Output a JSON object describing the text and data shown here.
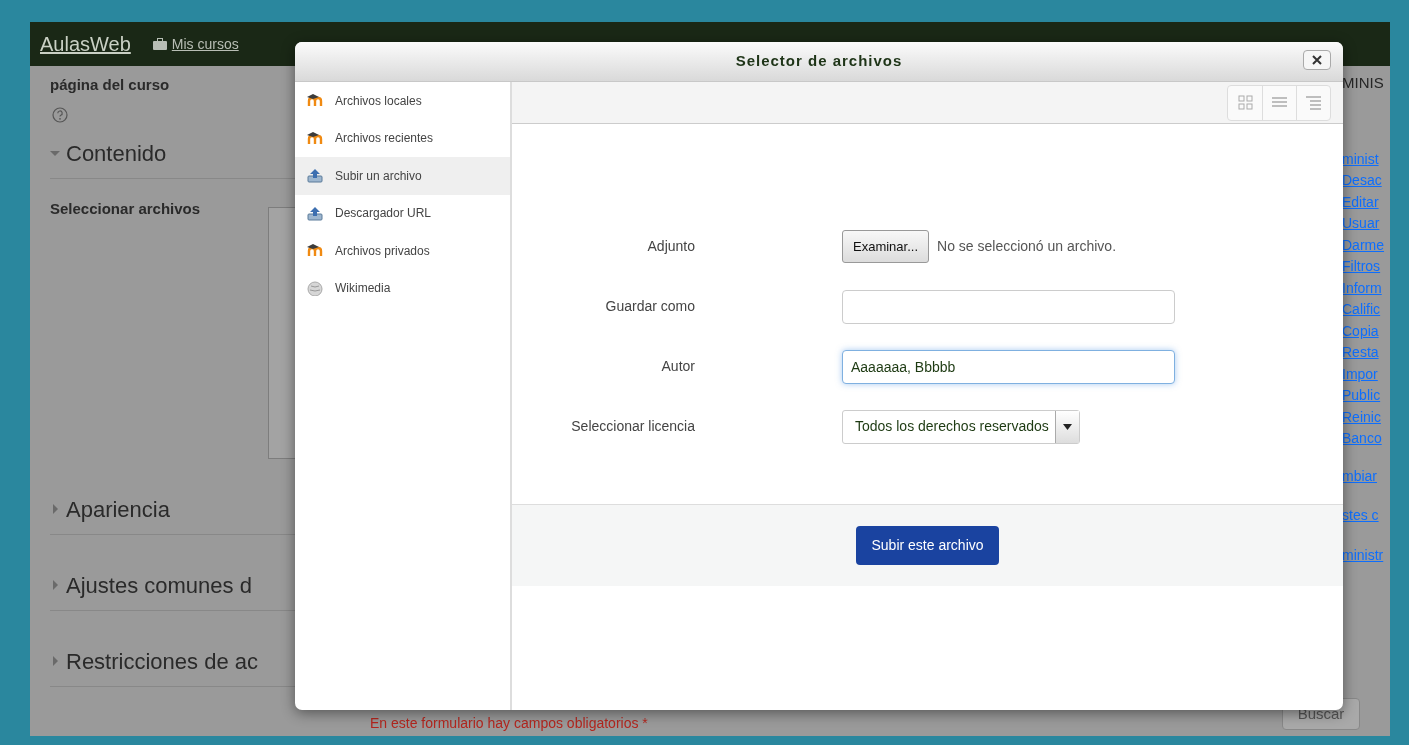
{
  "navbar": {
    "brand": "AulasWeb",
    "menu": "Mis cursos"
  },
  "course_form": {
    "description_label": "página del curso",
    "sections": [
      {
        "title": "Contenido",
        "expanded": true
      },
      {
        "title": "Apariencia",
        "expanded": false
      },
      {
        "title": "Ajustes comunes d",
        "expanded": false
      },
      {
        "title": "Restricciones de ac",
        "expanded": false
      }
    ],
    "files_label": "Seleccionar archivos",
    "required_notice": "En este formulario hay campos obligatorios",
    "required_mark": "*"
  },
  "admin_block": {
    "title": "MINIS",
    "items": [
      "minist",
      "Desac",
      "Editar",
      "Usuar",
      "Darme",
      "Filtros",
      "Inform",
      "Calific",
      "Copia",
      "Resta",
      "Impor",
      "Public",
      "Reinic",
      "Banco"
    ],
    "links": [
      "mbiar",
      "stes c",
      "ministr"
    ],
    "search_button": "Buscar"
  },
  "file_picker": {
    "title": "Selector de archivos",
    "repositories": [
      {
        "label": "Archivos locales",
        "kind": "moodle",
        "selected": false
      },
      {
        "label": "Archivos recientes",
        "kind": "moodle",
        "selected": false
      },
      {
        "label": "Subir un archivo",
        "kind": "upload",
        "selected": true
      },
      {
        "label": "Descargador URL",
        "kind": "upload",
        "selected": false
      },
      {
        "label": "Archivos privados",
        "kind": "moodle",
        "selected": false
      },
      {
        "label": "Wikimedia",
        "kind": "wikimedia",
        "selected": false
      }
    ],
    "fields": [
      {
        "label": "Adjunto",
        "kind": "file",
        "button": "Examinar...",
        "status": "No se seleccionó un archivo."
      },
      {
        "label": "Guardar como",
        "kind": "text",
        "focused": false
      },
      {
        "label": "Autor",
        "kind": "text",
        "value": "Aaaaaaa, Bbbbb",
        "focused": true
      },
      {
        "label": "Seleccionar licencia",
        "kind": "select",
        "value": "Todos los derechos reservados"
      }
    ],
    "submit_button": "Subir este archivo"
  }
}
